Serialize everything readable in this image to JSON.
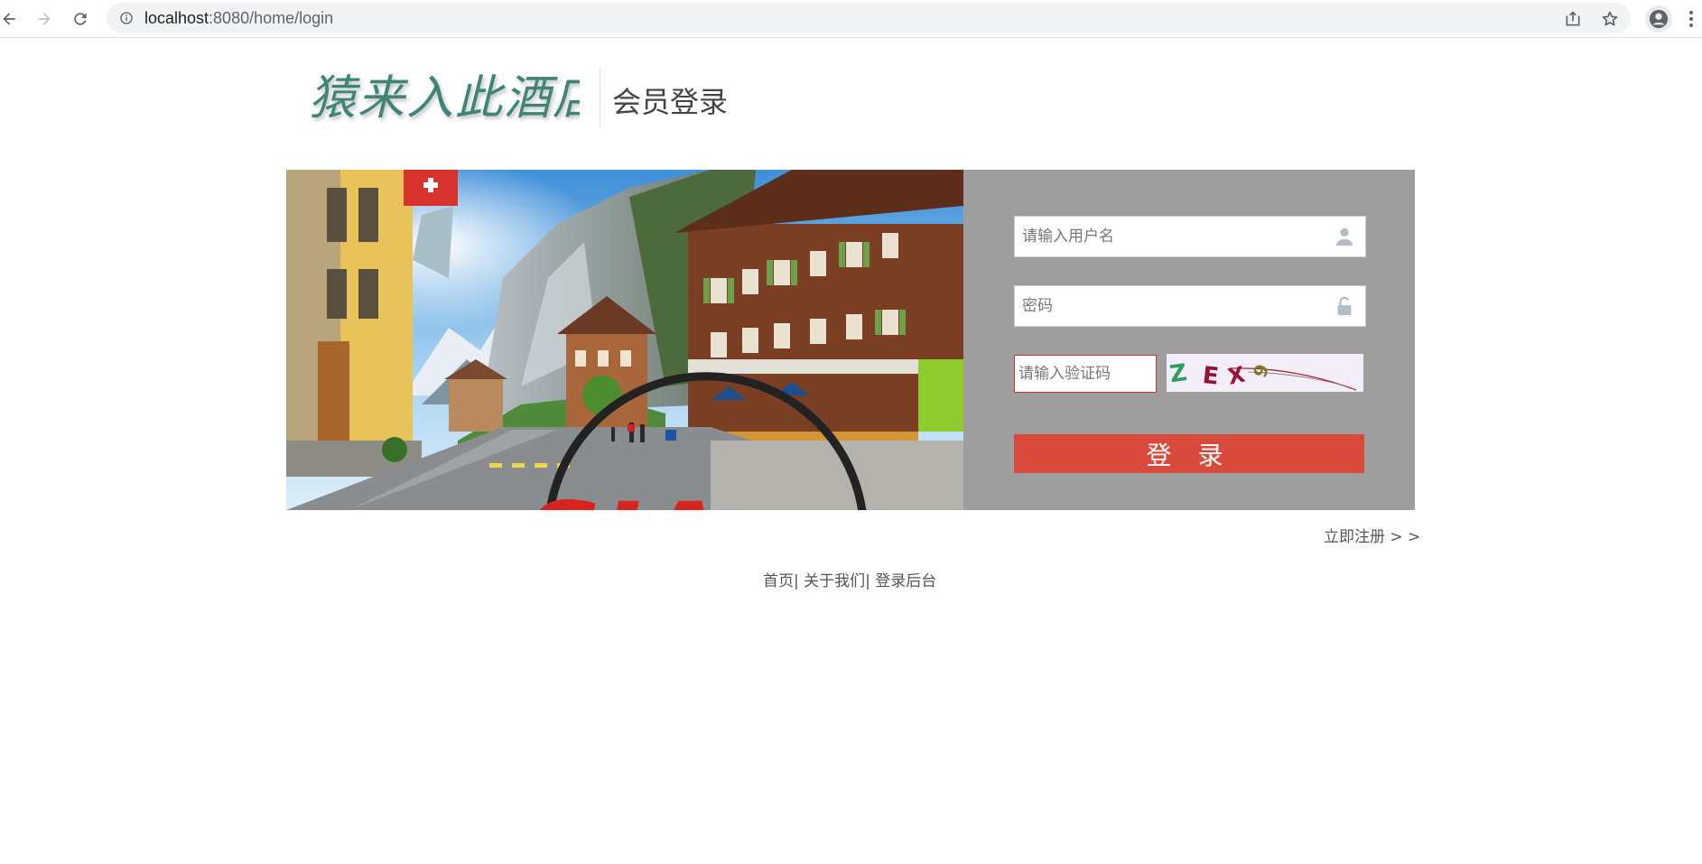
{
  "browser": {
    "url_host": "localhost",
    "url_rest": ":8080/home/login",
    "icons": [
      "back-icon",
      "forward-icon",
      "reload-icon",
      "info-icon",
      "share-icon",
      "star-icon",
      "profile-icon",
      "menu-icon"
    ]
  },
  "header": {
    "logo_text": "猿来入此酒店",
    "title": "会员登录"
  },
  "hero": {
    "watermark_text": "SIAsp"
  },
  "login": {
    "username_placeholder": "请输入用户名",
    "password_placeholder": "密码",
    "captcha_placeholder": "请输入验证码",
    "captcha_text": [
      "Z",
      "E",
      "X",
      "9"
    ],
    "submit_label": "登 录",
    "panel_color": "#9d9e9d",
    "button_color": "#d9493c"
  },
  "register": {
    "label": "立即注册 > >"
  },
  "footer": {
    "home": "首页",
    "sep1": "|",
    "about": " 关于我们",
    "sep2": "|",
    "admin": " 登录后台"
  }
}
